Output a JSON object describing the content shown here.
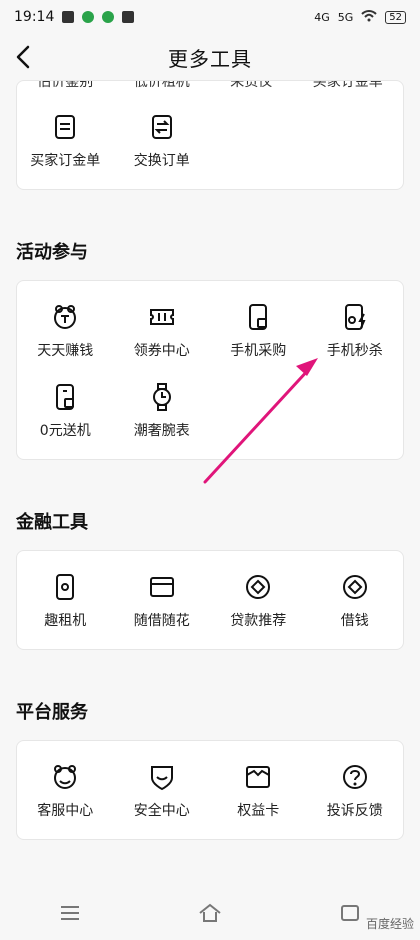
{
  "status": {
    "time": "19:14",
    "network": "4G",
    "network2": "5G",
    "battery": "52"
  },
  "header": {
    "title": "更多工具"
  },
  "top_truncated": {
    "items": [
      "估价鉴别",
      "低价租机",
      "采货仪",
      "买家订金单"
    ]
  },
  "top_tools": {
    "items": [
      {
        "label": "买家订金单",
        "icon": "receipt-icon"
      },
      {
        "label": "交换订单",
        "icon": "swap-receipt-icon"
      }
    ]
  },
  "sections": [
    {
      "title": "活动参与",
      "items": [
        {
          "label": "天天赚钱",
          "icon": "bear-coin-icon"
        },
        {
          "label": "领券中心",
          "icon": "coupon-icon"
        },
        {
          "label": "手机采购",
          "icon": "phone-purchase-icon"
        },
        {
          "label": "手机秒杀",
          "icon": "phone-flash-sale-icon"
        },
        {
          "label": "0元送机",
          "icon": "phone-gift-icon"
        },
        {
          "label": "潮奢腕表",
          "icon": "watch-icon"
        }
      ]
    },
    {
      "title": "金融工具",
      "items": [
        {
          "label": "趣租机",
          "icon": "phone-rent-icon"
        },
        {
          "label": "随借随花",
          "icon": "card-icon"
        },
        {
          "label": "贷款推荐",
          "icon": "loan-icon"
        },
        {
          "label": "借钱",
          "icon": "borrow-icon"
        }
      ]
    },
    {
      "title": "平台服务",
      "items": [
        {
          "label": "客服中心",
          "icon": "customer-service-icon"
        },
        {
          "label": "安全中心",
          "icon": "security-icon"
        },
        {
          "label": "权益卡",
          "icon": "benefit-card-icon"
        },
        {
          "label": "投诉反馈",
          "icon": "question-icon"
        }
      ]
    }
  ],
  "bottom_nav": {
    "items": [
      {
        "icon": "menu-icon"
      },
      {
        "icon": "home-icon"
      },
      {
        "icon": "back-icon"
      }
    ]
  },
  "watermark": "百度经验"
}
